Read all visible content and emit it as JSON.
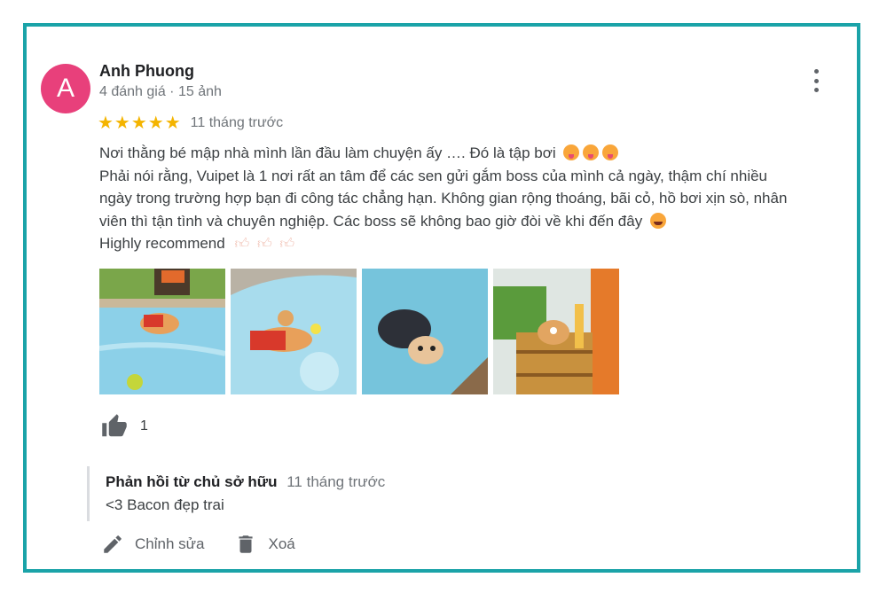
{
  "review": {
    "author": {
      "initial": "A",
      "name": "Anh Phuong",
      "meta": "4 đánh giá · 15 ảnh",
      "avatar_color": "#e8407b"
    },
    "stars": "★★★★★",
    "star_color": "#f4b400",
    "time": "11 tháng trước",
    "text_lines": [
      "Nơi thằng bé mập nhà mình lần đầu làm chuyện ấy …. Đó là tập bơi",
      "Phải nói rằng, Vuipet là 1 nơi rất an tâm để các sen gửi gắm boss của mình cả ngày, thậm chí nhiều",
      "ngày trong trường hợp bạn đi công tác chẳng hạn. Không gian rộng thoáng, bãi cỏ, hồ bơi xịn sò, nhân",
      "viên thì tận tình và chuyên nghiệp. Các boss sẽ không bao giờ đòi về khi đến đây",
      "Highly recommend"
    ],
    "icons": [
      "more-vert-icon",
      "thumb-up-icon",
      "edit-icon",
      "delete-icon"
    ],
    "likes": "1",
    "photo_count": 4
  },
  "owner_reply": {
    "title": "Phản hồi từ chủ sở hữu",
    "time": "11 tháng trước",
    "body": "<3 Bacon đẹp trai"
  },
  "actions": {
    "edit_label": "Chỉnh sửa",
    "delete_label": "Xoá"
  },
  "colors": {
    "accent_border": "#1aa3a8",
    "pool": "#7fc8e0"
  }
}
